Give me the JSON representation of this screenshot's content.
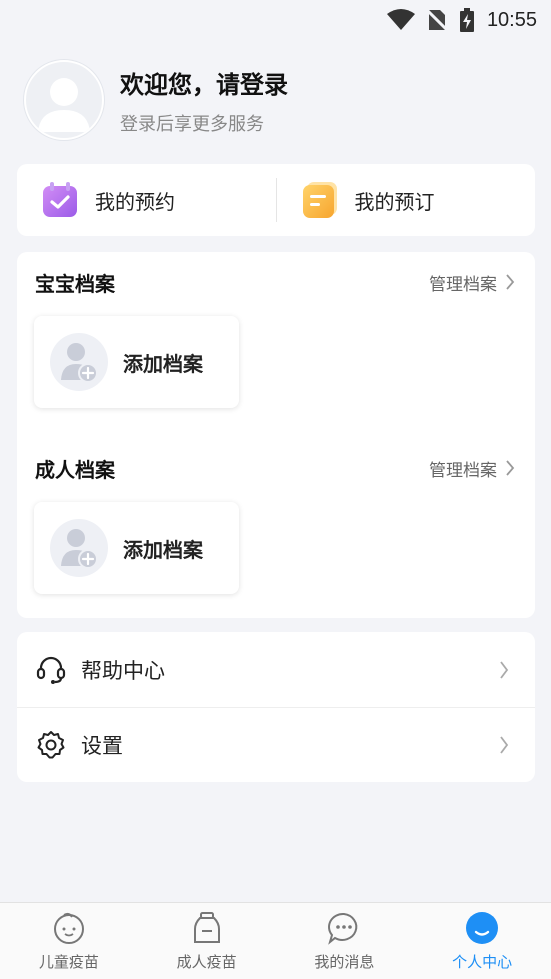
{
  "status_bar": {
    "time": "10:55"
  },
  "profile": {
    "title": "欢迎您，请登录",
    "subtitle": "登录后享更多服务"
  },
  "booking": {
    "items": [
      {
        "label": "我的预约",
        "icon": "calendar-check-icon",
        "color": "#a46cf0"
      },
      {
        "label": "我的预订",
        "icon": "order-list-icon",
        "color": "#f9b23c"
      }
    ]
  },
  "archives": {
    "baby": {
      "title": "宝宝档案",
      "manage": "管理档案",
      "add_label": "添加档案"
    },
    "adult": {
      "title": "成人档案",
      "manage": "管理档案",
      "add_label": "添加档案"
    }
  },
  "menu": {
    "items": [
      {
        "label": "帮助中心",
        "icon": "headset-icon"
      },
      {
        "label": "设置",
        "icon": "gear-icon"
      }
    ]
  },
  "tabs": [
    {
      "label": "儿童疫苗",
      "icon": "baby-face-icon",
      "active": false
    },
    {
      "label": "成人疫苗",
      "icon": "vaccine-bottle-icon",
      "active": false
    },
    {
      "label": "我的消息",
      "icon": "chat-bubble-icon",
      "active": false
    },
    {
      "label": "个人中心",
      "icon": "person-face-icon",
      "active": true
    }
  ],
  "colors": {
    "accent": "#1e8ff5",
    "background": "#f3f4f8",
    "booking_purple": "#a46cf0",
    "booking_orange": "#f9b23c"
  }
}
